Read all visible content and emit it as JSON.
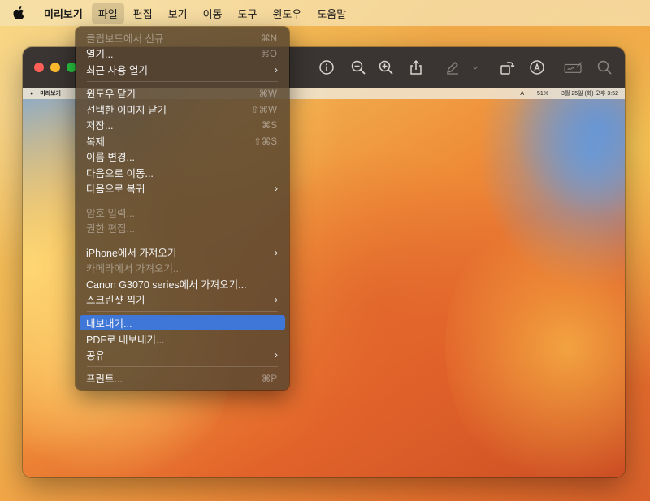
{
  "menubar": {
    "app_name": "미리보기",
    "menus": [
      "파일",
      "편집",
      "보기",
      "이동",
      "도구",
      "윈도우",
      "도움말"
    ],
    "active_menu": "파일"
  },
  "inner_menubar": {
    "app_name": "미리보기",
    "battery": "51%",
    "input_source": "A",
    "clock": "3월 25일 (화) 오후 3:52"
  },
  "toolbar_icons": [
    "info-icon",
    "zoom-out-icon",
    "zoom-in-icon",
    "share-icon",
    "markup-pen-icon",
    "chevron-down-icon",
    "rotate-icon",
    "annotate-icon",
    "signature-icon",
    "search-icon"
  ],
  "file_menu": {
    "items": [
      {
        "label": "클립보드에서 신규",
        "shortcut": "⌘N",
        "disabled": true
      },
      {
        "label": "열기...",
        "shortcut": "⌘O"
      },
      {
        "label": "최근 사용 열기",
        "submenu": true
      },
      {
        "label": "윈도우 닫기",
        "shortcut": "⌘W"
      },
      {
        "label": "선택한 이미지 닫기",
        "shortcut": "⇧⌘W"
      },
      {
        "label": "저장...",
        "shortcut": "⌘S"
      },
      {
        "label": "복제",
        "shortcut": "⇧⌘S"
      },
      {
        "label": "이름 변경..."
      },
      {
        "label": "다음으로 이동..."
      },
      {
        "label": "다음으로 복귀",
        "submenu": true
      },
      {
        "label": "암호 입력...",
        "disabled": true
      },
      {
        "label": "권한 편집...",
        "disabled": true
      },
      {
        "label": "iPhone에서 가져오기",
        "submenu": true
      },
      {
        "label": "카메라에서 가져오기...",
        "disabled": true
      },
      {
        "label": "Canon G3070 series에서 가져오기..."
      },
      {
        "label": "스크린샷 찍기",
        "submenu": true
      },
      {
        "label": "내보내기...",
        "highlighted": true
      },
      {
        "label": "PDF로 내보내기..."
      },
      {
        "label": "공유",
        "submenu": true
      },
      {
        "label": "프린트...",
        "shortcut": "⌘P"
      }
    ]
  },
  "colors": {
    "highlight": "#3f77d8",
    "menu_bg": "#58462f",
    "close": "#fe5f57",
    "minimize": "#febc2e",
    "zoom": "#28c840"
  }
}
